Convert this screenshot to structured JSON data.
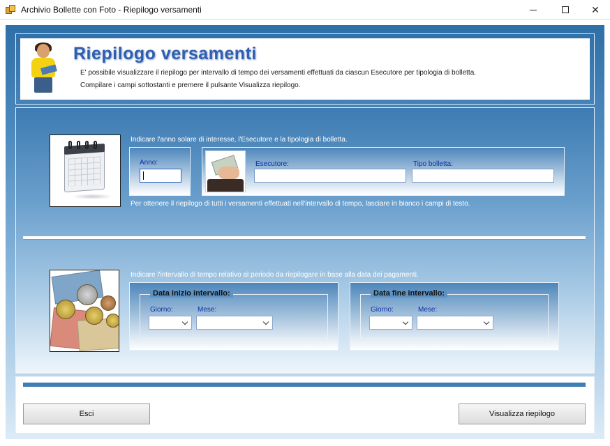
{
  "window": {
    "title": "Archivio Bollette con Foto - Riepilogo versamenti",
    "app_icon": "money-stack-icon",
    "controls": {
      "minimize": "minimize-icon",
      "maximize": "maximize-icon",
      "close": "✕"
    }
  },
  "header": {
    "title": "Riepilogo versamenti",
    "line1": "E' possibile visualizzare il riepilogo per intervallo di tempo dei versamenti effettuati da ciascun Esecutore per tipologia di bolletta.",
    "line2": "Compilare i campi sottostanti e premere il pulsante Visualizza riepilogo.",
    "title_color": "#2f5fb0"
  },
  "filters": {
    "intro": "Indicare l'anno solare di interesse, l'Esecutore e la tipologia di bolletta.",
    "anno_label": "Anno:",
    "anno_value": "",
    "esecutore_label": "Esecutore:",
    "esecutore_value": "",
    "tipo_label": "Tipo bolletta:",
    "tipo_value": "",
    "note": "Per ottenere il riepilogo di tutti i versamenti effettuati nell'intervallo di tempo, lasciare in bianco i campi di testo."
  },
  "interval": {
    "intro": "Indicare l'intervallo di tempo relativo al periodo da riepilogare in base alla data dei pagamenti.",
    "start": {
      "legend": "Data inizio intervallo:",
      "giorno_label": "Giorno:",
      "mese_label": "Mese:",
      "giorno_value": "",
      "mese_value": ""
    },
    "end": {
      "legend": "Data fine intervallo:",
      "giorno_label": "Giorno:",
      "mese_label": "Mese:",
      "giorno_value": "",
      "mese_value": ""
    }
  },
  "footer": {
    "esci_label": "Esci",
    "visualizza_label": "Visualizza riepilogo"
  },
  "colors": {
    "accent_blue": "#3f7db5",
    "label_blue": "#1030a0"
  }
}
